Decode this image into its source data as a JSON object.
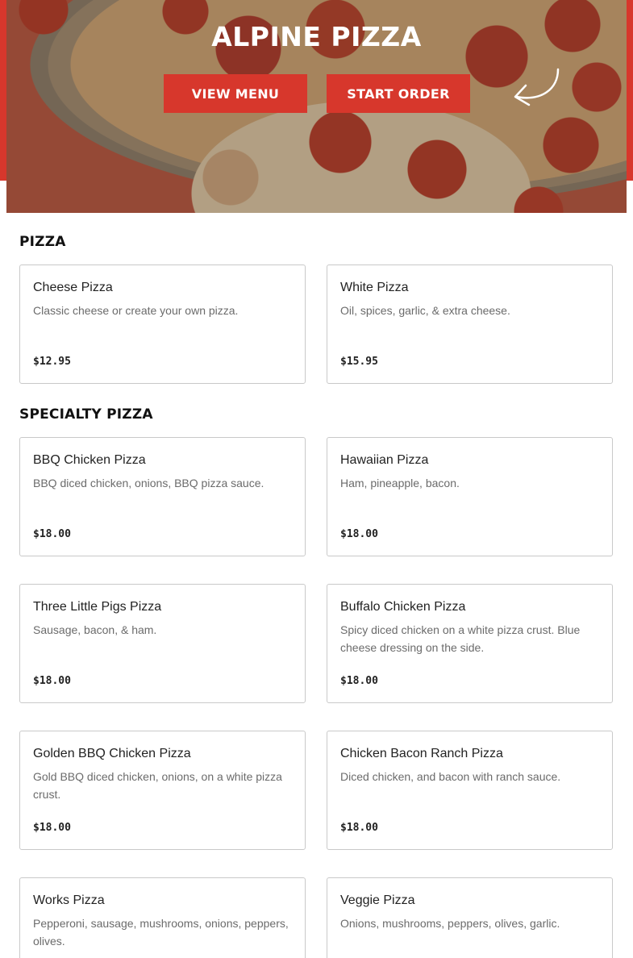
{
  "hero": {
    "title": "ALPINE PIZZA",
    "view_menu_label": "VIEW MENU",
    "start_order_label": "START ORDER"
  },
  "colors": {
    "accent": "#d7372c",
    "card_border": "#c9c9c9",
    "description_text": "#6b6b6b"
  },
  "sections": [
    {
      "title": "PIZZA",
      "items": [
        {
          "name": "Cheese Pizza",
          "description": "Classic cheese or create your own pizza.",
          "price": "$12.95"
        },
        {
          "name": "White Pizza",
          "description": "Oil, spices, garlic, & extra cheese.",
          "price": "$15.95"
        }
      ]
    },
    {
      "title": "SPECIALTY PIZZA",
      "items": [
        {
          "name": "BBQ Chicken Pizza",
          "description": "BBQ diced chicken, onions, BBQ pizza sauce.",
          "price": "$18.00"
        },
        {
          "name": "Hawaiian Pizza",
          "description": "Ham, pineapple, bacon.",
          "price": "$18.00"
        },
        {
          "name": "Three Little Pigs Pizza",
          "description": "Sausage, bacon, & ham.",
          "price": "$18.00"
        },
        {
          "name": "Buffalo Chicken Pizza",
          "description": "Spicy diced chicken on a white pizza crust. Blue cheese dressing on the side.",
          "price": "$18.00"
        },
        {
          "name": "Golden BBQ Chicken Pizza",
          "description": "Gold BBQ diced chicken, onions, on a white pizza crust.",
          "price": "$18.00"
        },
        {
          "name": "Chicken Bacon Ranch Pizza",
          "description": "Diced chicken, and bacon with ranch sauce.",
          "price": "$18.00"
        },
        {
          "name": "Works Pizza",
          "description": "Pepperoni, sausage, mushrooms, onions, peppers, olives.",
          "price": ""
        },
        {
          "name": "Veggie Pizza",
          "description": "Onions, mushrooms, peppers, olives, garlic.",
          "price": ""
        }
      ]
    }
  ]
}
